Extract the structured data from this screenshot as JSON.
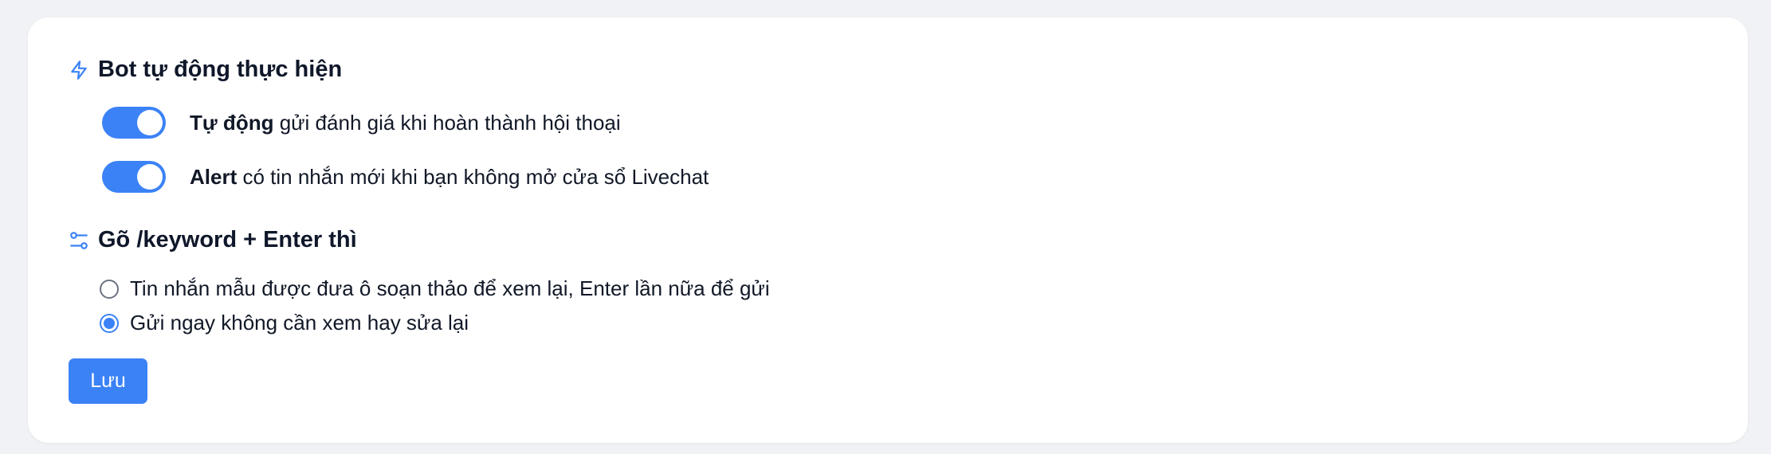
{
  "bot_section": {
    "icon": "lightning-icon",
    "title": "Bot tự động thực hiện",
    "toggles": [
      {
        "bold": "Tự động",
        "text": " gửi đánh giá khi hoàn thành hội thoại",
        "on": true
      },
      {
        "bold": "Alert",
        "text": " có tin nhắn mới khi bạn không mở cửa sổ Livechat",
        "on": true
      }
    ]
  },
  "keyword_section": {
    "icon": "sliders-icon",
    "title": "Gõ /keyword + Enter thì",
    "options": [
      {
        "label": "Tin nhắn mẫu được đưa ô soạn thảo để xem lại, Enter lần nữa để gửi",
        "checked": false
      },
      {
        "label": "Gửi ngay không cần xem hay sửa lại",
        "checked": true
      }
    ]
  },
  "save_label": "Lưu",
  "colors": {
    "accent": "#3b82f6",
    "background": "#f0f2f5",
    "card": "#ffffff"
  }
}
